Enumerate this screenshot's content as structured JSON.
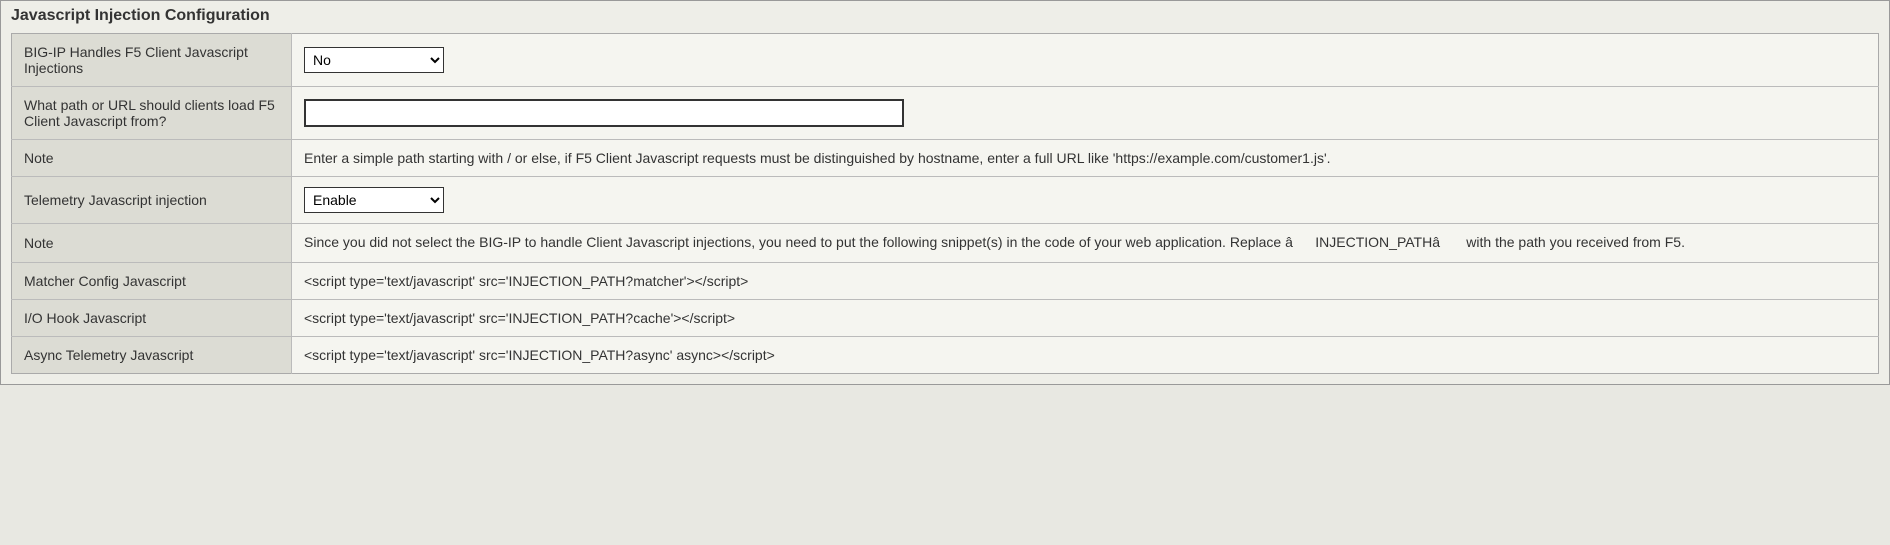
{
  "section": {
    "title": "Javascript Injection Configuration"
  },
  "rows": {
    "bigip_handles": {
      "label": "BIG-IP Handles F5 Client Javascript Injections",
      "value": "No"
    },
    "path_url": {
      "label": "What path or URL should clients load F5 Client Javascript from?",
      "value": ""
    },
    "note1": {
      "label": "Note",
      "value": "Enter a simple path starting with / or else, if F5 Client Javascript requests must be distinguished by hostname, enter a full URL like 'https://example.com/customer1.js'."
    },
    "telemetry": {
      "label": "Telemetry Javascript injection",
      "value": "Enable"
    },
    "note2": {
      "label": "Note",
      "value": "Since you did not select the BIG-IP to handle Client Javascript injections, you need to put the following snippet(s) in the code of your web application. Replace âINJECTION_PATHâ with the path you received from F5."
    },
    "matcher": {
      "label": "Matcher Config Javascript",
      "value": "<script type='text/javascript' src='INJECTION_PATH?matcher'></script>"
    },
    "iohook": {
      "label": "I/O Hook Javascript",
      "value": "<script type='text/javascript' src='INJECTION_PATH?cache'></script>"
    },
    "async": {
      "label": "Async Telemetry Javascript",
      "value": "<script type='text/javascript' src='INJECTION_PATH?async' async></script>"
    }
  }
}
